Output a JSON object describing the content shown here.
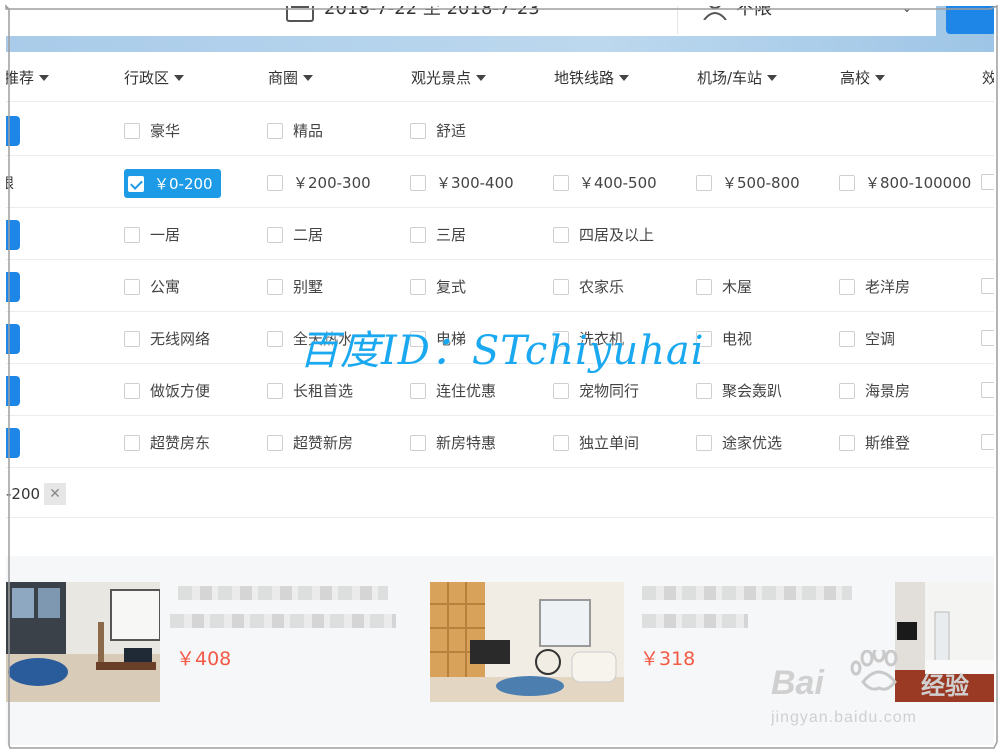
{
  "search": {
    "date_range": "2018-7-22 至 2018-7-23",
    "guests": "不限"
  },
  "filter_tabs": [
    {
      "label": "推荐"
    },
    {
      "label": "行政区"
    },
    {
      "label": "商圈"
    },
    {
      "label": "观光景点"
    },
    {
      "label": "地铁线路"
    },
    {
      "label": "机场/车站"
    },
    {
      "label": "高校"
    },
    {
      "label": "效"
    }
  ],
  "rows": [
    {
      "name": "level",
      "unlimit_selected": true,
      "options": [
        "豪华",
        "精品",
        "舒适"
      ]
    },
    {
      "name": "price",
      "unlimit_label": "限",
      "unlimit_selected": false,
      "selected_index": 0,
      "options": [
        "￥0-200",
        "￥200-300",
        "￥300-400",
        "￥400-500",
        "￥500-800",
        "￥800-100000"
      ]
    },
    {
      "name": "rooms",
      "unlimit_selected": true,
      "options": [
        "一居",
        "二居",
        "三居",
        "四居及以上"
      ]
    },
    {
      "name": "type",
      "unlimit_selected": true,
      "options": [
        "公寓",
        "别墅",
        "复式",
        "农家乐",
        "木屋",
        "老洋房"
      ]
    },
    {
      "name": "facilities",
      "unlimit_selected": true,
      "options": [
        "无线网络",
        "全天热水",
        "电梯",
        "洗衣机",
        "电视",
        "空调"
      ]
    },
    {
      "name": "features",
      "unlimit_selected": true,
      "options": [
        "做饭方便",
        "长租首选",
        "连住优惠",
        "宠物同行",
        "聚会轰趴",
        "海景房"
      ]
    },
    {
      "name": "special",
      "unlimit_selected": true,
      "options": [
        "超赞房东",
        "超赞新房",
        "新房特惠",
        "独立单间",
        "途家优选",
        "斯维登"
      ]
    }
  ],
  "selected_tag": {
    "label": "-200",
    "close": "✕"
  },
  "listings": [
    {
      "price": "￥408"
    },
    {
      "price": "￥318"
    }
  ],
  "watermark": {
    "id_text": "百度ID：STchiyuhai",
    "baidu_logo": "Baidu经验",
    "baidu_url": "jingyan.baidu.com"
  },
  "colors": {
    "accent": "#1e86e6",
    "selected": "#1e9be6",
    "price": "#f25a46",
    "watermark": "#1aa9f0"
  }
}
